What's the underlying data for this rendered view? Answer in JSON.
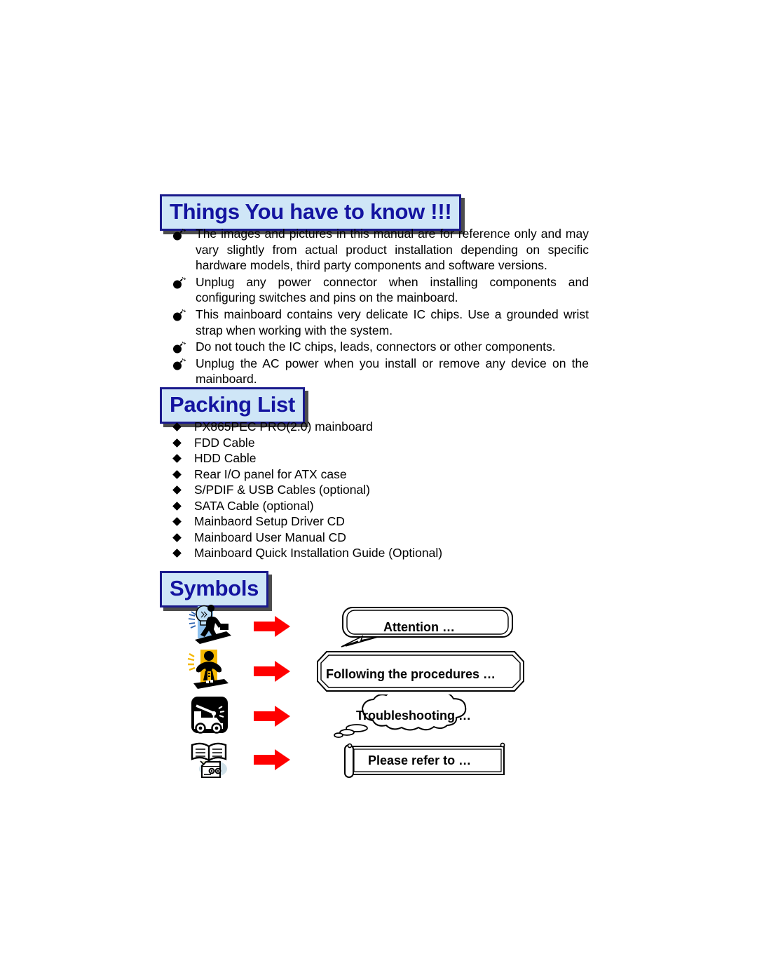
{
  "document": {
    "page_background": "#ffffff",
    "header_fill": "#cfe6f7",
    "header_text_color": "#1414a0",
    "header_border_color": "#1a1a8c",
    "arrow_color": "#ff0000"
  },
  "sections": {
    "things_to_know": {
      "title": "Things You have to know !!!",
      "bullet_icon": "bomb-icon",
      "items": [
        "The images and pictures in this manual are for reference only and may vary slightly from actual product installation depending on specific hardware models, third party components and software versions.",
        "Unplug any power connector when installing components and configuring switches and pins on the mainboard.",
        "This mainboard contains very delicate IC chips. Use a grounded wrist strap when working with the system.",
        "Do not touch the IC chips, leads, connectors or other components.",
        "Unplug the AC power when you install or remove any device on the mainboard."
      ]
    },
    "packing_list": {
      "title": "Packing List",
      "bullet_icon": "diamond-icon",
      "items": [
        "PX865PEC PRO(2.0) mainboard",
        "FDD Cable",
        "HDD Cable",
        "Rear I/O panel for ATX case",
        "S/PDIF & USB Cables (optional)",
        "SATA Cable (optional)",
        "Mainbaord Setup Driver CD",
        "Mainboard User Manual CD",
        "Mainboard Quick Installation Guide (Optional)"
      ]
    },
    "symbols": {
      "title": "Symbols",
      "rows": [
        {
          "icon": "idea-businessman-lightbulb-icon",
          "arrow": "red-right-arrow-icon",
          "callout_shape": "rounded-rectangle-lightning-callout",
          "label": "Attention …"
        },
        {
          "icon": "figure-crossed-arms-icon",
          "arrow": "red-right-arrow-icon",
          "callout_shape": "octagonal-callout",
          "label": "Following the procedures …"
        },
        {
          "icon": "tow-truck-icon",
          "arrow": "red-right-arrow-icon",
          "callout_shape": "cloud-thought-callout",
          "label": "Troubleshooting …"
        },
        {
          "icon": "open-book-reader-icon",
          "arrow": "red-right-arrow-icon",
          "callout_shape": "scroll-banner-callout",
          "label": "Please refer to …"
        }
      ]
    }
  }
}
